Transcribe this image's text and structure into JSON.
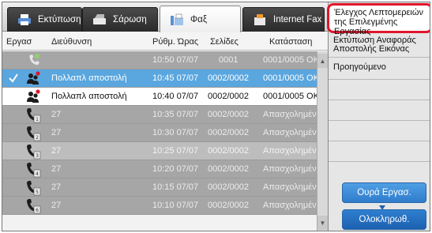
{
  "tabs": [
    {
      "label": "Εκτύπωση",
      "icon": "print-icon"
    },
    {
      "label": "Σάρωση",
      "icon": "scan-icon"
    },
    {
      "label": "Φαξ",
      "icon": "fax-icon"
    },
    {
      "label": "Internet Fax",
      "icon": "internet-fax-icon"
    }
  ],
  "columns": {
    "job": "Εργασ",
    "address": "Διεύθυνση",
    "time": "Ρύθμ. Ώρας",
    "pages": "Σελίδες",
    "status": "Κατάσταση"
  },
  "rows": [
    {
      "address": "",
      "time": "10:50 07/07",
      "pages": "0001",
      "status": "0001/0005 OK",
      "icon": "fax-single-icon",
      "style": "grey",
      "checked": false
    },
    {
      "address": "Πολλαπλ αποστολή",
      "time": "10:45 07/07",
      "pages": "0002/0002",
      "status": "0001/0005 OK",
      "icon": "broadcast-icon",
      "style": "selected",
      "checked": true
    },
    {
      "address": "Πολλαπλ αποστολή",
      "time": "10:40 07/07",
      "pages": "0002/0002",
      "status": "0001/0005 OK",
      "icon": "broadcast-icon",
      "style": "white",
      "checked": false
    },
    {
      "address": "27",
      "time": "10:35 07/07",
      "pages": "0002/0002",
      "status": "Απασχολημένο",
      "icon": "fax-busy-icon",
      "style": "grey",
      "checked": false
    },
    {
      "address": "27",
      "time": "10:30 07/07",
      "pages": "0002/0002",
      "status": "Απασχολημένο",
      "icon": "fax-busy-icon",
      "style": "grey",
      "checked": false
    },
    {
      "address": "27",
      "time": "10:25 07/07",
      "pages": "0002/0002",
      "status": "Απασχολημένο",
      "icon": "fax-busy-icon",
      "style": "light",
      "checked": false
    },
    {
      "address": "27",
      "time": "10:20 07/07",
      "pages": "0002/0002",
      "status": "Απασχολημένο",
      "icon": "fax-busy-icon",
      "style": "grey",
      "checked": false
    },
    {
      "address": "27",
      "time": "10:15 07/07",
      "pages": "0002/0002",
      "status": "Απασχολημένο",
      "icon": "fax-busy-icon",
      "style": "grey",
      "checked": false
    },
    {
      "address": "27",
      "time": "10:10 07/07",
      "pages": "0002/0002",
      "status": "Απασχολημένο",
      "icon": "fax-busy-icon",
      "style": "grey",
      "checked": false
    }
  ],
  "panel": {
    "check_details": "Έλεγχος Λεπτομερειών της Επιλεγμένης Εργασίας",
    "print_report": "Εκτύπωση Αναφοράς Αποστολής Εικόνας",
    "advanced": "Προηγούμενο",
    "job_queue": "Ουρά Εργασ.",
    "complete": "Ολοκληρωθ."
  },
  "colors": {
    "selected_row": "#5aa6df",
    "grey_row": "#a6a6a6",
    "highlight_border": "#e0162b",
    "button_blue": "#2f7ccc"
  }
}
